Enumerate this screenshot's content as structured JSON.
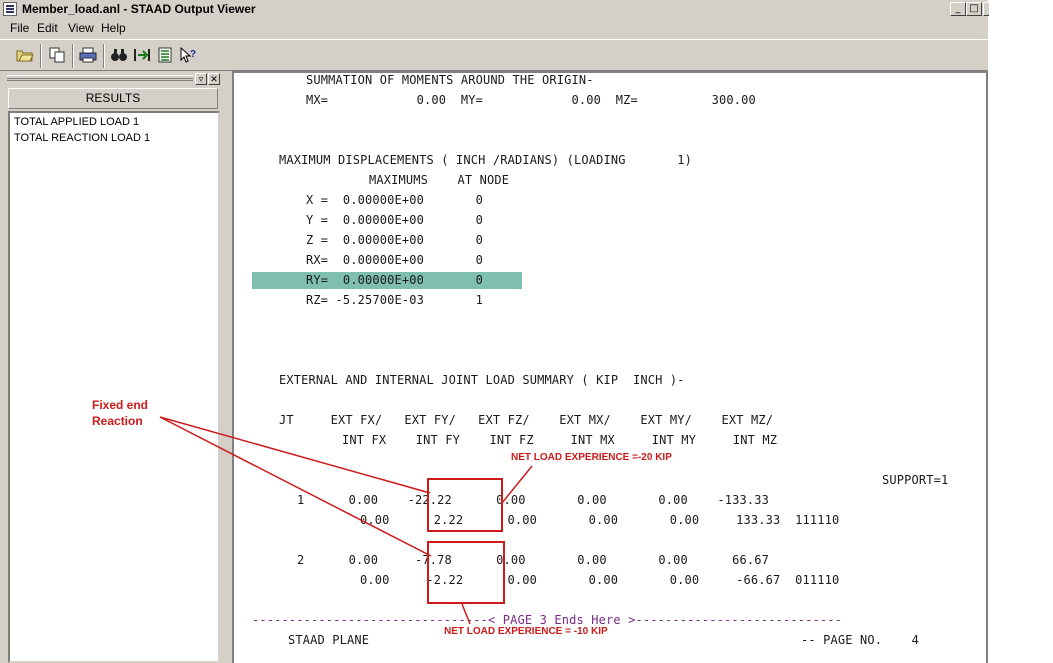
{
  "window": {
    "title": "Member_load.anl - STAAD Output Viewer",
    "controls": {
      "minimize": "_",
      "maximize": "□",
      "close": "✕"
    }
  },
  "menu": [
    {
      "label": "File"
    },
    {
      "label": "Edit"
    },
    {
      "label": "View"
    },
    {
      "label": "Help"
    }
  ],
  "toolbar": [
    {
      "icon": "open-folder-icon"
    },
    {
      "icon": "copy-icon"
    },
    {
      "icon": "print-icon"
    },
    {
      "icon": "find-icon"
    },
    {
      "icon": "goto-icon"
    },
    {
      "icon": "list-icon"
    },
    {
      "icon": "help-pointer-icon"
    }
  ],
  "left_pane": {
    "header": "RESULTS",
    "items": [
      {
        "label": "TOTAL APPLIED LOAD    1"
      },
      {
        "label": "TOTAL REACTION LOAD   1"
      }
    ]
  },
  "report": {
    "lines": [
      "SUMMATION OF MOMENTS AROUND THE ORIGIN-",
      "MX=            0.00  MY=            0.00  MZ=          300.00",
      "MAXIMUM DISPLACEMENTS ( INCH /RADIANS) (LOADING       1)",
      "MAXIMUMS    AT NODE",
      "X =  0.00000E+00       0",
      "Y =  0.00000E+00       0",
      "Z =  0.00000E+00       0",
      "RX=  0.00000E+00       0",
      "RY=  0.00000E+00       0",
      "RZ= -5.25700E-03       1",
      "EXTERNAL AND INTERNAL JOINT LOAD SUMMARY ( KIP  INCH )-",
      "JT     EXT FX/   EXT FY/   EXT FZ/    EXT MX/    EXT MY/    EXT MZ/",
      "INT FX    INT FY    INT FZ     INT MX     INT MY     INT MZ",
      "SUPPORT=1",
      "1      0.00    -22.22      0.00       0.00       0.00    -133.33",
      "0.00      2.22      0.00       0.00       0.00     133.33  111110",
      "2      0.00     -7.78      0.00       0.00       0.00      66.67",
      "0.00     -2.22      0.00       0.00       0.00     -66.67  011110",
      "--------------------------------< PAGE 3 Ends Here >----------------------------",
      "STAAD PLANE",
      "-- PAGE NO.    4"
    ]
  },
  "annotations": {
    "fixed_end": [
      "Fixed end",
      "Reaction"
    ],
    "net_load_1": "NET LOAD EXPERIENCE =-20 KIP",
    "net_load_2": "NET LOAD EXPERIENCE = -10 KIP"
  },
  "colors": {
    "annotation": "#cc1b1b",
    "row_highlight": "#7fbfb0",
    "page_break": "#7a2a86"
  }
}
